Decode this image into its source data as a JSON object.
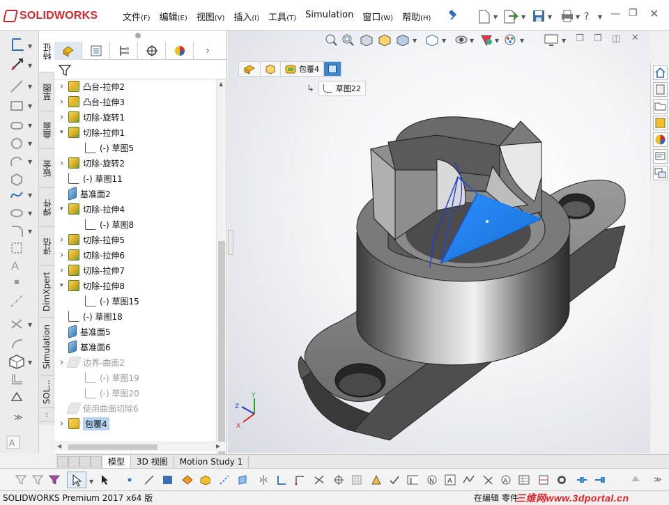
{
  "app": {
    "brand": "SOLIDWORKS"
  },
  "menu": [
    {
      "label": "文件",
      "key": "(F)"
    },
    {
      "label": "编辑",
      "key": "(E)"
    },
    {
      "label": "视图",
      "key": "(V)"
    },
    {
      "label": "插入",
      "key": "(I)"
    },
    {
      "label": "工具",
      "key": "(T)"
    },
    {
      "label": "Simulation",
      "key": ""
    },
    {
      "label": "窗口",
      "key": "(W)"
    },
    {
      "label": "帮助",
      "key": "(H)"
    }
  ],
  "vtabs": [
    "特征",
    "草图",
    "曲面",
    "钣金",
    "焊件",
    "评估",
    "DimXpert",
    "Simulation",
    "SOL..."
  ],
  "tree": [
    {
      "label": "凸台-拉伸2",
      "icon": "boss-extrude-icon",
      "indent": 0,
      "expand": true,
      "state": "normal"
    },
    {
      "label": "凸台-拉伸3",
      "icon": "boss-extrude-icon",
      "indent": 0,
      "expand": true,
      "state": "normal"
    },
    {
      "label": "切除-旋转1",
      "icon": "cut-revolve-icon",
      "indent": 0,
      "expand": true,
      "state": "normal"
    },
    {
      "label": "切除-拉伸1",
      "icon": "cut-extrude-icon",
      "indent": 0,
      "expand": true,
      "state": "open"
    },
    {
      "label": "(-) 草图5",
      "icon": "sketch-icon",
      "indent": 1,
      "expand": false,
      "state": "normal"
    },
    {
      "label": "切除-旋转2",
      "icon": "cut-revolve-icon",
      "indent": 0,
      "expand": true,
      "state": "normal"
    },
    {
      "label": "(-) 草图11",
      "icon": "sketch-icon",
      "indent": 0,
      "expand": false,
      "state": "normal"
    },
    {
      "label": "基准面2",
      "icon": "plane-icon",
      "indent": 0,
      "expand": false,
      "state": "normal"
    },
    {
      "label": "切除-拉伸4",
      "icon": "cut-extrude-icon",
      "indent": 0,
      "expand": true,
      "state": "open"
    },
    {
      "label": "(-) 草图8",
      "icon": "sketch-icon",
      "indent": 1,
      "expand": false,
      "state": "normal"
    },
    {
      "label": "切除-拉伸5",
      "icon": "cut-extrude-icon",
      "indent": 0,
      "expand": true,
      "state": "normal"
    },
    {
      "label": "切除-拉伸6",
      "icon": "cut-extrude-icon",
      "indent": 0,
      "expand": true,
      "state": "normal"
    },
    {
      "label": "切除-拉伸7",
      "icon": "cut-extrude-icon",
      "indent": 0,
      "expand": true,
      "state": "normal"
    },
    {
      "label": "切除-拉伸8",
      "icon": "cut-extrude-icon",
      "indent": 0,
      "expand": true,
      "state": "open"
    },
    {
      "label": "(-) 草图15",
      "icon": "sketch-icon",
      "indent": 1,
      "expand": false,
      "state": "normal"
    },
    {
      "label": "(-) 草图18",
      "icon": "sketch-icon",
      "indent": 0,
      "expand": false,
      "state": "normal"
    },
    {
      "label": "基准面5",
      "icon": "plane-icon",
      "indent": 0,
      "expand": false,
      "state": "normal"
    },
    {
      "label": "基准面6",
      "icon": "plane-icon",
      "indent": 0,
      "expand": false,
      "state": "normal"
    },
    {
      "label": "边界-曲面2",
      "icon": "boundary-surface-icon",
      "indent": 0,
      "expand": true,
      "state": "dim"
    },
    {
      "label": "(-) 草图19",
      "icon": "sketch-icon",
      "indent": 1,
      "expand": false,
      "state": "dim"
    },
    {
      "label": "(-) 草图20",
      "icon": "sketch-icon",
      "indent": 1,
      "expand": false,
      "state": "dim"
    },
    {
      "label": "使用曲面切除6",
      "icon": "surface-cut-icon",
      "indent": 0,
      "expand": false,
      "state": "dim"
    },
    {
      "label": "包覆4",
      "icon": "wrap-icon",
      "indent": 0,
      "expand": true,
      "state": "selected"
    }
  ],
  "breadcrumb": {
    "item": "包覆4",
    "sketch": "草图22"
  },
  "doctabs": [
    "模型",
    "3D 视图",
    "Motion Study 1"
  ],
  "status": {
    "product": "SOLIDWORKS Premium 2017 x64 版",
    "editing": "在编辑 零件"
  },
  "watermark": "三维网www.3dportal.cn",
  "triad": {
    "x": "X",
    "y": "Y",
    "z": "Z"
  },
  "colors": {
    "brand": "#d4252a",
    "selection": "#1e90ff",
    "watermark": "#e02020"
  }
}
